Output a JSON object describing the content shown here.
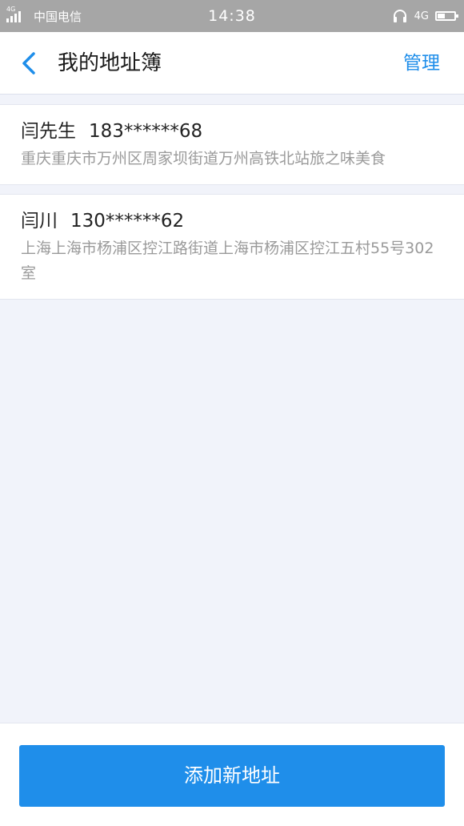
{
  "status_bar": {
    "network_badge": "4G",
    "carrier": "中国电信",
    "time": "14:38",
    "network_type": "4G",
    "icons": [
      "signal-icon",
      "headphones-icon",
      "battery-icon"
    ]
  },
  "header": {
    "title": "我的地址簿",
    "manage_label": "管理",
    "back_icon": "chevron-left-icon",
    "accent_color": "#1f8eea"
  },
  "addresses": [
    {
      "name": "闫先生",
      "phone": "183******68",
      "address": "重庆重庆市万州区周家坝街道万州高铁北站旅之味美食"
    },
    {
      "name": "闫川",
      "phone": "130******62",
      "address": "上海上海市杨浦区控江路街道上海市杨浦区控江五村55号302室"
    }
  ],
  "footer": {
    "add_button_label": "添加新地址"
  }
}
